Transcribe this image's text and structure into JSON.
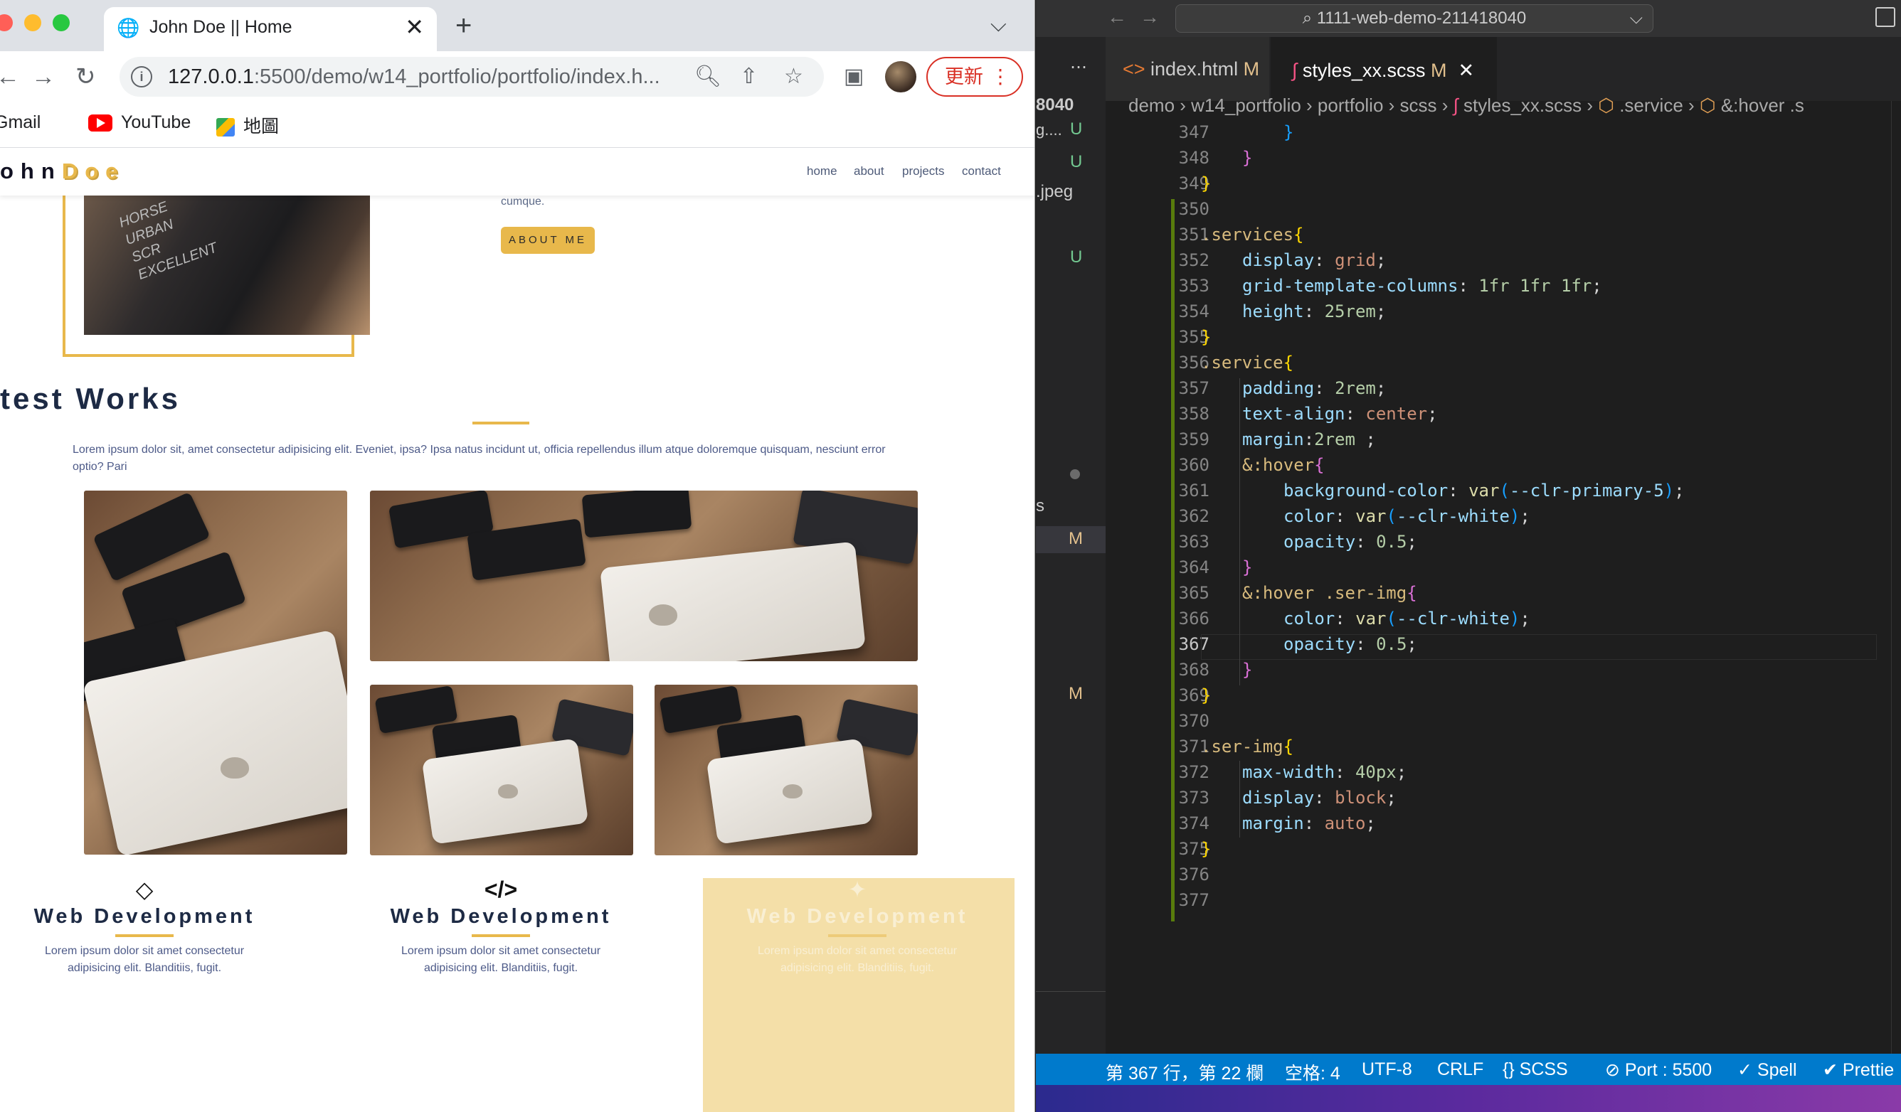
{
  "browser": {
    "tab_title": "John Doe || Home",
    "url_host": "127.0.0.1",
    "url_rest": ":5500/demo/w14_portfolio/portfolio/index.h...",
    "update_label": "更新",
    "bookmarks": [
      {
        "label": "Gmail"
      },
      {
        "label": "YouTube"
      },
      {
        "label": "地圖"
      }
    ]
  },
  "site": {
    "logo_main": "ohn",
    "logo_accent": "Doe",
    "nav": [
      "home",
      "about",
      "projects",
      "contact"
    ],
    "hero_shirt_text": "HORSE\nURBAN\nSCR\nEXCELLENT",
    "cumque_text": "cumque.",
    "about_button": "ABOUT ME",
    "works_title": "test Works",
    "works_desc": "Lorem ipsum dolor sit, amet consectetur adipisicing elit. Eveniet, ipsa? Ipsa natus incidunt ut, officia repellendus illum atque doloremque quisquam, nesciunt error optio? Pari",
    "services": [
      {
        "icon": "diamond-icon",
        "title": "Web Development",
        "desc": "Lorem ipsum dolor sit amet consectetur adipisicing elit. Blanditiis, fugit."
      },
      {
        "icon": "code-icon",
        "title": "Web Development",
        "desc": "Lorem ipsum dolor sit amet consectetur adipisicing elit. Blanditiis, fugit."
      },
      {
        "icon": "rocket-icon",
        "title": "Web Development",
        "desc": "Lorem ipsum dolor sit amet consectetur adipisicing elit. Blanditiis, fugit."
      }
    ]
  },
  "vscode": {
    "command_center": "1111-web-demo-211418040",
    "sidebar": {
      "top": "8040",
      "frag1": "g....",
      "frag2": ".jpeg",
      "frag3": "s",
      "badges": [
        "U",
        "U",
        "U",
        "M",
        "M"
      ]
    },
    "tabs": [
      {
        "label": "index.html",
        "badge": "M"
      },
      {
        "label": "styles_xx.scss",
        "badge": "M"
      }
    ],
    "breadcrumbs": [
      "demo",
      "w14_portfolio",
      "portfolio",
      "scss",
      "styles_xx.scss",
      ".service",
      "&:hover .s"
    ],
    "line_numbers": [
      "347",
      "348",
      "349",
      "350",
      "351",
      "352",
      "353",
      "354",
      "355",
      "356",
      "357",
      "358",
      "359",
      "360",
      "361",
      "362",
      "363",
      "364",
      "365",
      "366",
      "367",
      "368",
      "369",
      "370",
      "371",
      "372",
      "373",
      "374",
      "375",
      "376",
      "377"
    ],
    "current_line": "367",
    "code": {
      "l347": "}",
      "l348": "}",
      "l349": "}",
      "l351_sel": ".services",
      "l352": [
        "display",
        "grid"
      ],
      "l353": [
        "grid-template-columns",
        "1fr 1fr 1fr"
      ],
      "l354": [
        "height",
        "25rem"
      ],
      "l356_sel": ".service",
      "l357": [
        "padding",
        "2rem"
      ],
      "l358": [
        "text-align",
        "center"
      ],
      "l359": [
        "margin",
        "2rem"
      ],
      "l360_sel": "&:hover",
      "l361": [
        "background-color",
        "var",
        "--clr-primary-5"
      ],
      "l362": [
        "color",
        "var",
        "--clr-white"
      ],
      "l363": [
        "opacity",
        "0.5"
      ],
      "l365_sel": "&:hover .ser-img",
      "l366": [
        "color",
        "var",
        "--clr-white"
      ],
      "l367": [
        "opacity",
        "0.5"
      ],
      "l371_sel": ".ser-img",
      "l372": [
        "max-width",
        "40px"
      ],
      "l373": [
        "display",
        "block"
      ],
      "l374": [
        "margin",
        "auto"
      ]
    },
    "status": {
      "position": "第 367 行，第 22 欄",
      "spaces": "空格: 4",
      "encoding": "UTF-8",
      "eol": "CRLF",
      "language": "SCSS",
      "port": "Port : 5500",
      "spell": "Spell",
      "prettier": "Prettie"
    }
  }
}
